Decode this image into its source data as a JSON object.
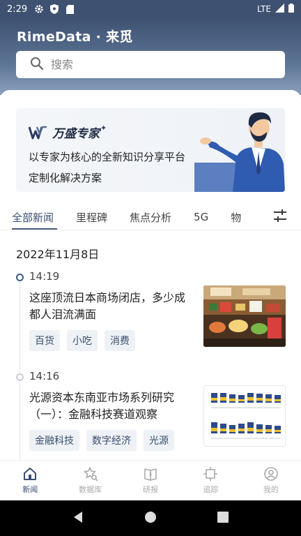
{
  "status_bar": {
    "time": "2:29",
    "network": "LTE"
  },
  "header": {
    "brand": "RimeData · 来觅"
  },
  "search": {
    "placeholder": "搜索"
  },
  "banner": {
    "logo_text": "万盛专家",
    "line1": "以专家为核心的全新知识分享平台",
    "line2": "定制化解决方案"
  },
  "tabs": [
    "全部新闻",
    "里程碑",
    "焦点分析",
    "5G",
    "物"
  ],
  "news": {
    "date": "2022年11月8日",
    "items": [
      {
        "time": "14:19",
        "title_line1": "这座顶流日本商场闭店，多少成",
        "title_line2": "都人泪流满面",
        "tags": [
          "百货",
          "小吃",
          "消费"
        ]
      },
      {
        "time": "14:16",
        "title_line1": "光源资本东南亚市场系列研究",
        "title_line2": "（一）：金融科技赛道观察",
        "tags": [
          "金融科技",
          "数字经济",
          "光源"
        ]
      }
    ]
  },
  "bottom_nav": [
    {
      "label": "新闻",
      "icon": "home-icon"
    },
    {
      "label": "数据库",
      "icon": "star-search-icon"
    },
    {
      "label": "研报",
      "icon": "book-icon"
    },
    {
      "label": "追踪",
      "icon": "track-icon"
    },
    {
      "label": "我的",
      "icon": "user-icon"
    }
  ],
  "colors": {
    "header": "#3e5171",
    "accent": "#3a4e6f",
    "tag_bg": "#eef1f5"
  }
}
